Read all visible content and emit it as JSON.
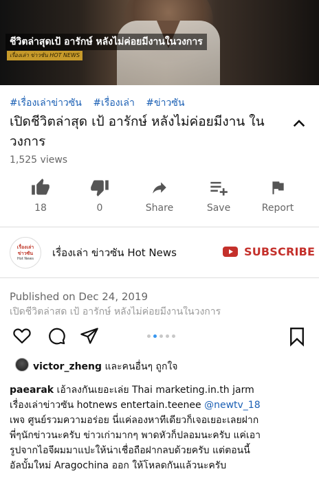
{
  "video": {
    "overlay_title": "ชีวิตล่าสุดเป้ อารักษ์ หลังไม่ค่อยมีงานในวงการ",
    "overlay_source": "เรื่องเล่า ข่าวซัน HOT NEWS"
  },
  "hashtags": [
    "#เรื่องเล่าข่าวซัน",
    "#เรื่องเล่า",
    "#ข่าวซัน"
  ],
  "title": "เปิดชีวิตล่าสุด เป้ อารักษ์ หลังไม่ค่อยมีงาน ในวงการ",
  "views": "1,525 views",
  "actions": {
    "like": {
      "label": "18",
      "icon": "thumbs-up-icon"
    },
    "dislike": {
      "label": "0",
      "icon": "thumbs-down-icon"
    },
    "share": {
      "label": "Share",
      "icon": "share-arrow-icon"
    },
    "save": {
      "label": "Save",
      "icon": "playlist-add-icon"
    },
    "report": {
      "label": "Report",
      "icon": "flag-icon"
    }
  },
  "channel": {
    "name": "เรื่องเล่า ข่าวซัน Hot News",
    "logo_line1": "เรื่องเล่า",
    "logo_line2": "ข่าวซัน",
    "logo_line3": "Hot News",
    "subscribe_label": "SUBSCRIBE"
  },
  "published": "Published on Dec 24, 2019",
  "description_preview": "เปิดชีวิตล่าสุด เป้ อารักษ์ หลังไม่ค่อยมีงานในวงการ",
  "instagram": {
    "carousel": {
      "count": 5,
      "active": 1
    },
    "likes": {
      "user": "victor_zheng",
      "suffix": "และคนอื่นๆ ถูกใจ"
    },
    "caption": {
      "user": "paearak",
      "line1": "เอ้าลงกันเยอะเล่ย Thai marketing.in.th jarm",
      "line2_text": "เรื่องเล่าข่าวซัน hotnews entertain.teenee ",
      "line2_mention": "@newtv_18",
      "line3": "เพจ ศูนย์รวมความอร่อย นี่แค่ลองหาทีเดียวก็เจอเยอะเลยฝาก",
      "line4": "พี่ๆนักข่าวนะครับ ข่าวเก่ามากๆ พาดหัวก็ปลอมนะครับ แค่เอา",
      "line5": "รูปจากไอจีผมมาแปะให้น่าเชื่อถือฝากลบด้วยครับ แต่ตอนนี้",
      "line6": "อัลบั้มใหม่ Aragochina ออก ให้โหลดกันแล้วนะครับ"
    }
  },
  "colors": {
    "link_blue": "#1a5fb4",
    "subscribe_red": "#c4302b",
    "secondary_text": "#666666",
    "dot_active": "#3897f0"
  }
}
